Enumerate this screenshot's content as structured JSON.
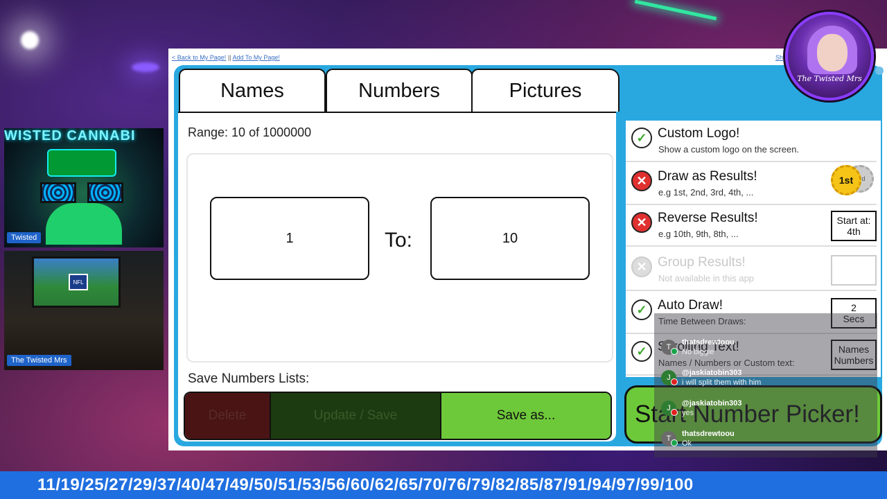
{
  "top_links": {
    "back": "< Back to My Page!",
    "separator": "||",
    "add": "Add To My Page!",
    "share": "Sh"
  },
  "tabs": [
    {
      "label": "Names",
      "active": false
    },
    {
      "label": "Numbers",
      "active": true
    },
    {
      "label": "Pictures",
      "active": false
    }
  ],
  "numbers_panel": {
    "range_text": "Range: 10 of 1000000",
    "from_value": "1",
    "to_label": "To:",
    "to_value": "10",
    "save_lists_label": "Save Numbers Lists:",
    "buttons": {
      "delete": "Delete",
      "update_save": "Update / Save",
      "save_as": "Save as..."
    }
  },
  "options": [
    {
      "title": "Custom Logo!",
      "desc": "Show a custom logo on the screen.",
      "state": "on",
      "side": ""
    },
    {
      "title": "Draw as Results!",
      "desc": "e.g 1st, 2nd, 3rd, 4th, ...",
      "state": "off",
      "side": "",
      "medal_1": "1st",
      "medal_2": "2nd"
    },
    {
      "title": "Reverse Results!",
      "desc": "e.g 10th, 9th, 8th, ...",
      "state": "off",
      "side_line1": "Start at:",
      "side_line2": "4th"
    },
    {
      "title": "Group Results!",
      "desc": "Not available in this app",
      "state": "disabled",
      "side": ""
    },
    {
      "title": "Auto Draw!",
      "desc": "Time Between Draws:",
      "state": "on",
      "side_line1": "2",
      "side_line2": "Secs"
    },
    {
      "title": "Scrolling Text!",
      "desc": "Names / Numbers or Custom text:",
      "state": "on",
      "side_line1": "Names",
      "side_line2": "Numbers"
    }
  ],
  "start_button": "Start Number Picker!",
  "webcams": {
    "cam1_brand": "WISTED CANNABI",
    "cam1_label": "Twisted",
    "cam2_tv_logo": "NFL",
    "cam2_label": "The Twisted Mrs"
  },
  "avatar_text": "The Twisted Mrs",
  "chat": [
    {
      "user": "thatsdrewtoou",
      "text": "No biggie",
      "avatar": "T",
      "avatar_color": "#6b6b6b",
      "platform": "kick"
    },
    {
      "user": "@jaskiatobin303",
      "text": "i will split them with him",
      "avatar": "J",
      "avatar_color": "#2e7d32",
      "platform": "youtube"
    },
    {
      "user": "@jaskiatobin303",
      "text": "yes",
      "avatar": "J",
      "avatar_color": "#2e7d32",
      "platform": "youtube"
    },
    {
      "user": "thatsdrewtoou",
      "text": "Ok",
      "avatar": "T",
      "avatar_color": "#6b6b6b",
      "platform": "kick"
    }
  ],
  "ticker": "11/19/25/27/29/37/40/47/49/50/51/53/56/60/62/65/70/76/79/82/85/87/91/94/97/99/100",
  "colors": {
    "app_blue": "#29a8e0",
    "start_green": "#6ec93a",
    "ticker_blue": "#1f6fe0",
    "check_green": "#3ca82b",
    "cross_red": "#e03030"
  },
  "icons": {
    "on": "check-circle-icon",
    "off": "cross-circle-icon",
    "disabled": "cross-circle-disabled-icon"
  }
}
